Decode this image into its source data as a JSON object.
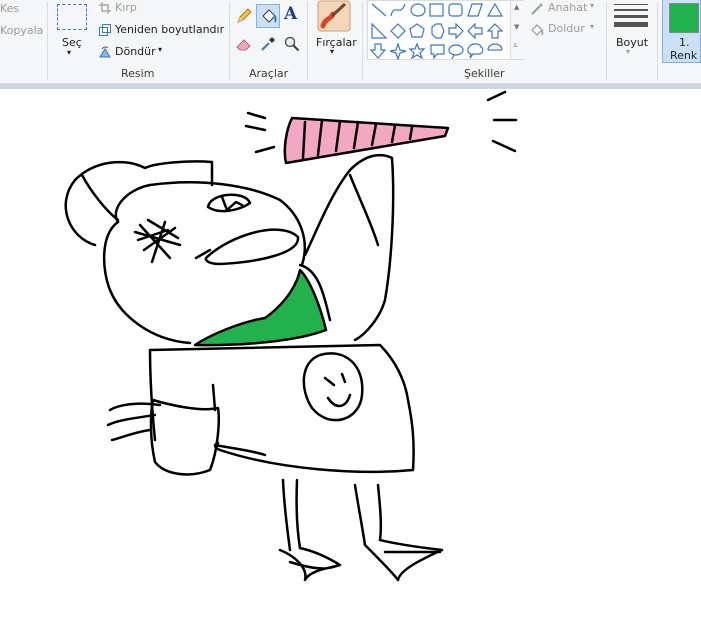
{
  "ribbon": {
    "clipboard": {
      "cut_label": "Kes",
      "copy_label": "Kopyala"
    },
    "image_group": {
      "select_label": "Seç",
      "crop_label": "Kırp",
      "resize_label": "Yeniden boyutlandır",
      "rotate_label": "Döndür",
      "group_label": "Resim"
    },
    "tools_group": {
      "group_label": "Araçlar",
      "tools": [
        "pencil-icon",
        "fill-icon",
        "text-icon",
        "eraser-icon",
        "color-picker-icon",
        "magnifier-icon"
      ],
      "active_tool": "fill-icon"
    },
    "brushes": {
      "label": "Fırçalar"
    },
    "shapes_group": {
      "group_label": "Şekiller",
      "outline_label": "Anahat",
      "fill_label": "Doldur"
    },
    "size": {
      "label": "Boyut"
    },
    "color1": {
      "label_line1": "1.",
      "label_line2": "Renk",
      "color": "#22b14c"
    }
  },
  "colors": {
    "ribbon_bg": "#f5f6f7",
    "selected_bg": "#c9e0f7",
    "selected_border": "#7eb4ea",
    "horn_pink": "#f4a7c3",
    "body_green": "#22b14c",
    "text_icon_blue": "#1f3e82"
  },
  "canvas": {
    "drawing": "character-sketch"
  }
}
